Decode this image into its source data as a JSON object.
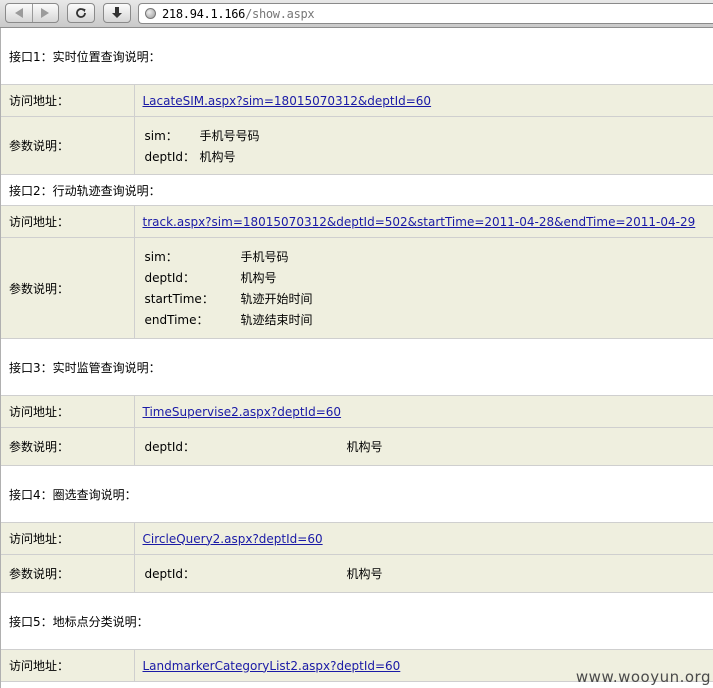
{
  "browser": {
    "url_host": "218.94.1.166",
    "url_path": "/show.aspx"
  },
  "labels": {
    "address": "访问地址：",
    "params": "参数说明："
  },
  "sections": [
    {
      "heading": "接口1：实时位置查询说明：",
      "url": "LacateSIM.aspx?sim=18015070312&deptId=60",
      "params": [
        {
          "name": "sim：",
          "desc": "手机号号码"
        },
        {
          "name": "deptId：",
          "desc": "机构号"
        }
      ]
    },
    {
      "heading": "接口2：行动轨迹查询说明：",
      "url": "track.aspx?sim=18015070312&deptId=502&startTime=2011-04-28&endTime=2011-04-29",
      "params": [
        {
          "name": "sim：",
          "desc": "手机号码"
        },
        {
          "name": "deptId：",
          "desc": "机构号"
        },
        {
          "name": "startTime：",
          "desc": "轨迹开始时间"
        },
        {
          "name": "endTime：",
          "desc": "轨迹结束时间"
        }
      ]
    },
    {
      "heading": "接口3：实时监管查询说明：",
      "url": "TimeSupervise2.aspx?deptId=60",
      "params": [
        {
          "name": "deptId：",
          "desc": "机构号"
        }
      ]
    },
    {
      "heading": "接口4：圈选查询说明：",
      "url": "CircleQuery2.aspx?deptId=60",
      "params": [
        {
          "name": "deptId：",
          "desc": "机构号"
        }
      ]
    },
    {
      "heading": "接口5：地标点分类说明：",
      "url": "LandmarkerCategoryList2.aspx?deptId=60"
    }
  ],
  "watermark": "www.wooyun.org"
}
